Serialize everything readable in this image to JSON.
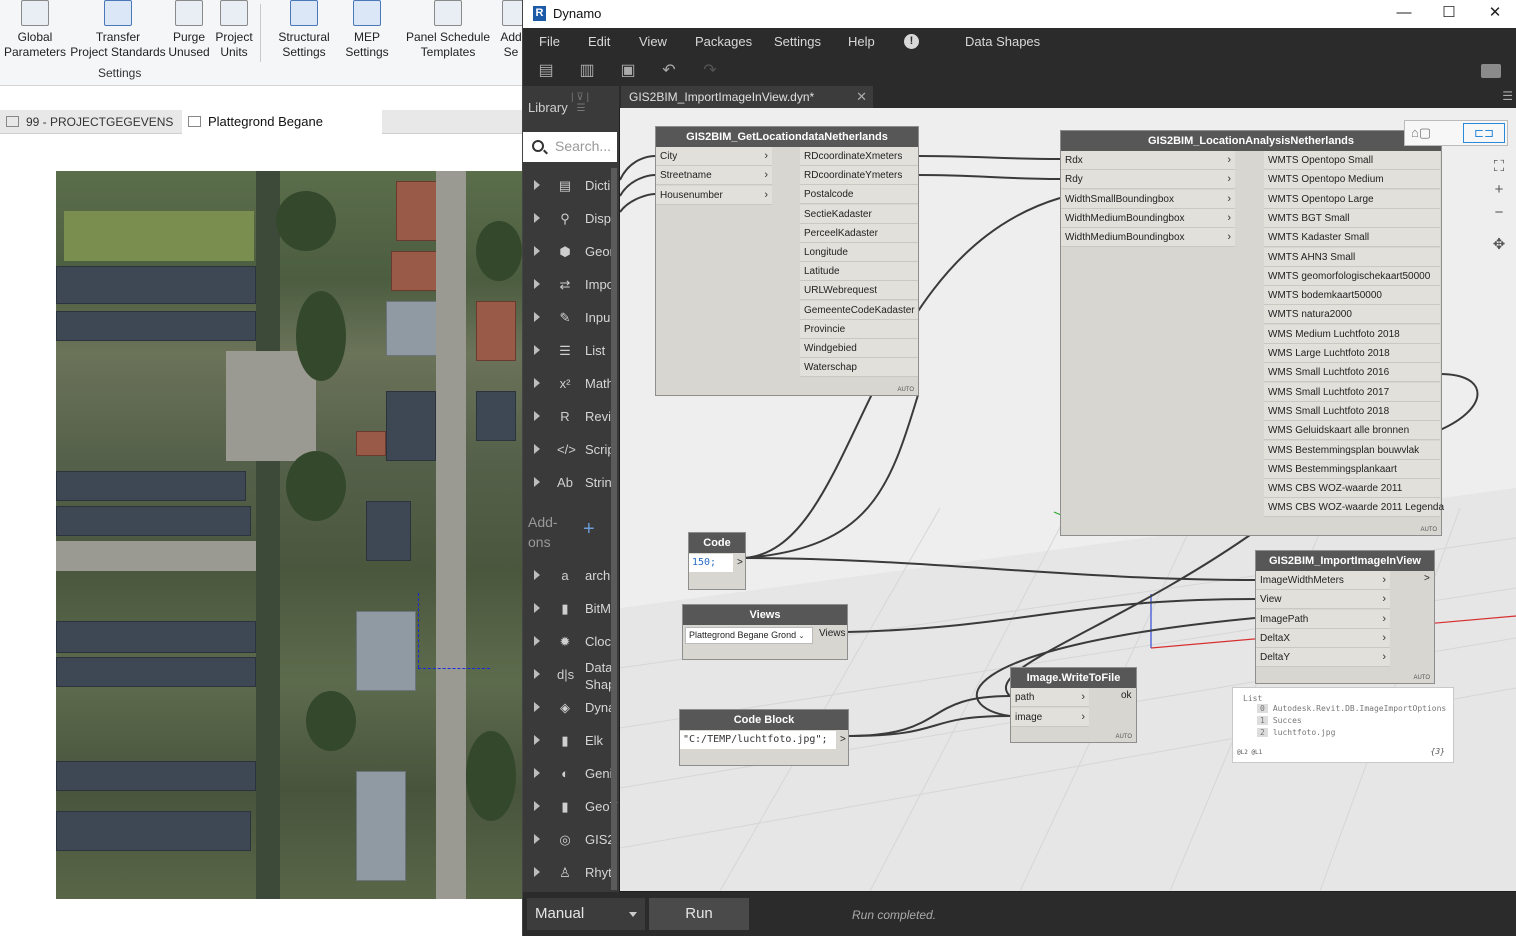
{
  "revit": {
    "ribbon": [
      {
        "line1": "Global",
        "line2": "Parameters"
      },
      {
        "line1": "Transfer",
        "line2": "Project Standards"
      },
      {
        "line1": "Purge",
        "line2": "Unused"
      },
      {
        "line1": "Project",
        "line2": "Units"
      },
      {
        "line1": "Structural",
        "line2": "Settings"
      },
      {
        "line1": "MEP",
        "line2": "Settings"
      },
      {
        "line1": "Panel Schedule",
        "line2": "Templates"
      },
      {
        "line1": "Add",
        "line2": "Se"
      }
    ],
    "ribbon_panel_label": "Settings",
    "tabs": [
      {
        "label": "99 - PROJECTGEGEVENS"
      },
      {
        "label": "Plattegrond Begane Grond",
        "close": "✕"
      }
    ]
  },
  "dynamo": {
    "title": "Dynamo",
    "logo": "R",
    "window_buttons": {
      "minimize": "—",
      "maximize": "☐",
      "close": "✕"
    },
    "menu": [
      "File",
      "Edit",
      "View",
      "Packages",
      "Settings",
      "Help"
    ],
    "menu_info": "!",
    "menu_extra": "Data Shapes",
    "library": {
      "title": "Library",
      "search_placeholder": "Search...",
      "categories": [
        {
          "label": "Dicti",
          "icon": "dictionary-icon",
          "glyph": "▤"
        },
        {
          "label": "Disp",
          "icon": "display-icon",
          "glyph": "⚲"
        },
        {
          "label": "Geor",
          "icon": "geometry-icon",
          "glyph": "⬢"
        },
        {
          "label": "Impo",
          "icon": "import-export-icon",
          "glyph": "⇄"
        },
        {
          "label": "Inpu",
          "icon": "input-icon",
          "glyph": "✎"
        },
        {
          "label": "List",
          "icon": "list-icon",
          "glyph": "☰"
        },
        {
          "label": "Math",
          "icon": "math-icon",
          "glyph": "x²"
        },
        {
          "label": "Revi",
          "icon": "revit-icon",
          "glyph": "R"
        },
        {
          "label": "Scrip",
          "icon": "script-icon",
          "glyph": "</>"
        },
        {
          "label": "Strin",
          "icon": "string-icon",
          "glyph": "Ab"
        }
      ],
      "addons_label": "Add-\nons",
      "addons_plus": "+",
      "packages": [
        {
          "label": "arch",
          "icon": "archilab-icon",
          "glyph": "a"
        },
        {
          "label": "BitM",
          "icon": "bimorph-icon",
          "glyph": "▮"
        },
        {
          "label": "Clocl",
          "icon": "clockwork-icon",
          "glyph": "✹"
        },
        {
          "label": "Data\nShap",
          "icon": "data-shapes-icon",
          "glyph": "d|s"
        },
        {
          "label": "Dyna",
          "icon": "dynamo-icon",
          "glyph": "◈"
        },
        {
          "label": "Elk",
          "icon": "elk-icon",
          "glyph": "▮"
        },
        {
          "label": "Geni",
          "icon": "genius-loci-icon",
          "glyph": "◐"
        },
        {
          "label": "GeoT",
          "icon": "geotools-icon",
          "glyph": "▮"
        },
        {
          "label": "GIS2",
          "icon": "gis2bim-icon",
          "glyph": "◎"
        },
        {
          "label": "Rhyt",
          "icon": "rhythm-icon",
          "glyph": "♙"
        }
      ]
    },
    "tab": {
      "label": "GIS2BIM_ImportImageInView.dyn*",
      "close": "✕"
    },
    "nodes": {
      "getloc": {
        "title": "GIS2BIM_GetLocationdataNetherlands",
        "inputs": [
          "City",
          "Streetname",
          "Housenumber"
        ],
        "outputs": [
          "RDcoordinateXmeters",
          "RDcoordinateYmeters",
          "Postalcode",
          "SectieKadaster",
          "PerceelKadaster",
          "Longitude",
          "Latitude",
          "URLWebrequest",
          "GemeenteCodeKadaster",
          "Provincie",
          "Windgebied",
          "Waterschap"
        ],
        "auto": "AUTO"
      },
      "analysis": {
        "title": "GIS2BIM_LocationAnalysisNetherlands",
        "inputs": [
          "Rdx",
          "Rdy",
          "WidthSmallBoundingbox",
          "WidthMediumBoundingbox",
          "WidthMediumBoundingbox"
        ],
        "outputs": [
          "WMTS Opentopo Small",
          "WMTS Opentopo Medium",
          "WMTS Opentopo Large",
          "WMTS BGT Small",
          "WMTS Kadaster Small",
          "WMTS AHN3 Small",
          "WMTS geomorfologischekaart50000",
          "WMTS bodemkaart50000",
          "WMTS natura2000",
          "WMS Medium Luchtfoto 2018",
          "WMS Large Luchtfoto 2018",
          "WMS Small Luchtfoto 2016",
          "WMS Small Luchtfoto 2017",
          "WMS Small Luchtfoto 2018",
          "WMS Geluidskaart alle bronnen",
          "WMS Bestemmingsplan bouwvlak",
          "WMS Bestemmingsplankaart",
          "WMS CBS WOZ-waarde 2011",
          "WMS CBS WOZ-waarde 2011 Legenda"
        ],
        "auto": "AUTO"
      },
      "code1": {
        "title": "Code Block",
        "code": "150;",
        "out": ">"
      },
      "views": {
        "title": "Views",
        "value": "Plattegrond Begane Grond",
        "output": "Views"
      },
      "code2": {
        "title": "Code Block",
        "code": "\"C:/TEMP/luchtfoto.jpg\";",
        "out": ">"
      },
      "write": {
        "title": "Image.WriteToFile",
        "inputs": [
          "path",
          "image"
        ],
        "output": "ok",
        "auto": "AUTO"
      },
      "import": {
        "title": "GIS2BIM_ImportImageInView",
        "inputs": [
          "ImageWidthMeters",
          "View",
          "ImagePath",
          "DeltaX",
          "DeltaY"
        ],
        "output": ">",
        "auto": "AUTO"
      }
    },
    "watch": {
      "header": "List",
      "items": [
        {
          "index": "0",
          "value": "Autodesk.Revit.DB.ImageImportOptions"
        },
        {
          "index": "1",
          "value": "Succes"
        },
        {
          "index": "2",
          "value": "luchtfoto.jpg"
        }
      ],
      "levels": "@L2 @L1",
      "count": "{3}"
    },
    "run_mode": "Manual",
    "run_button": "Run",
    "status": "Run completed."
  }
}
